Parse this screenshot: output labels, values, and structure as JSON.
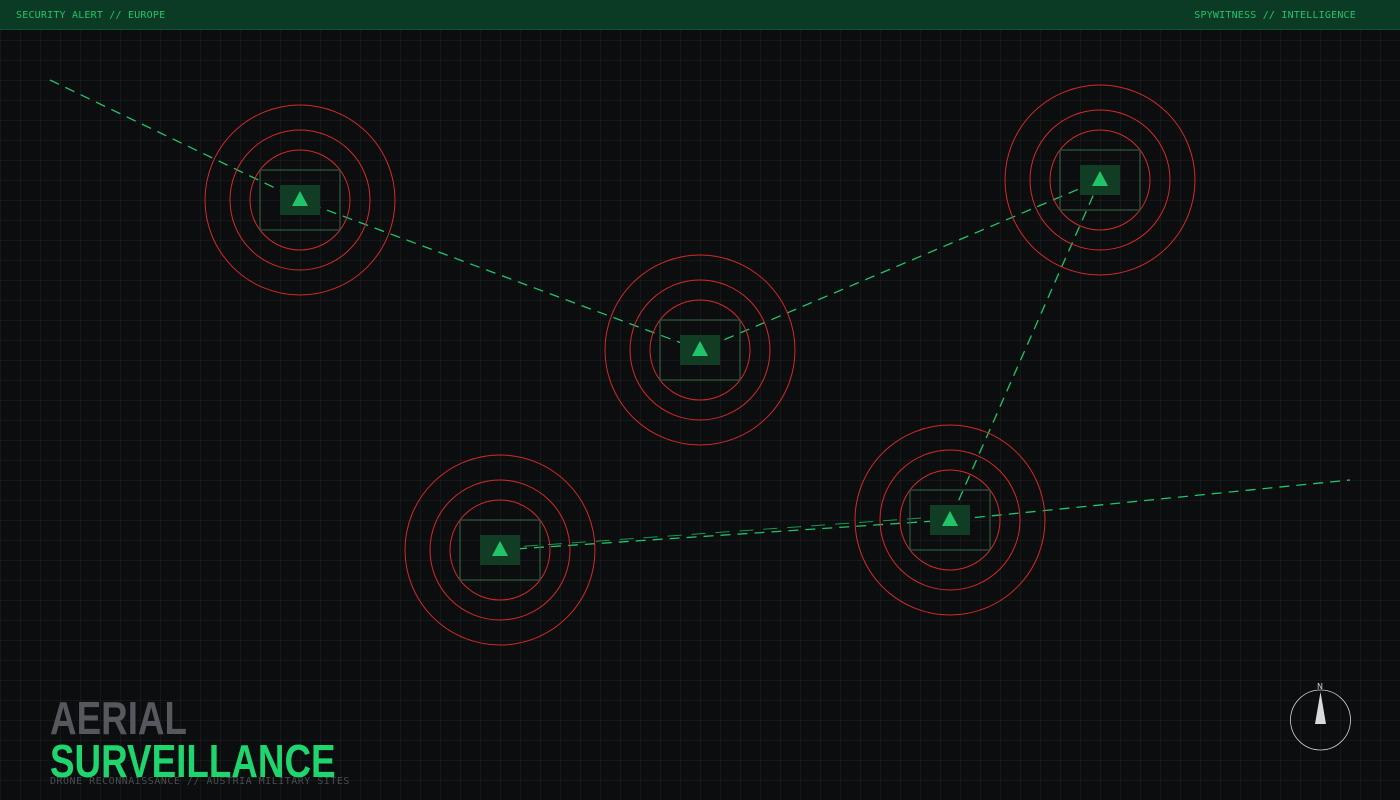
{
  "header": {
    "left_label": "SECURITY ALERT // EUROPE",
    "right_label": "SPYWITNESS // INTELLIGENCE"
  },
  "title": {
    "line1": "AERIAL",
    "line2": "SURVEILLANCE",
    "subtitle": "DRONE RECONNAISSANCE // AUSTRIA MILITARY SITES"
  },
  "compass": {
    "label": "N"
  },
  "colors": {
    "accent": "#22c46a",
    "alert_ring": "#d42a2a",
    "site_box": "#2f5a3c",
    "header_bg": "#0b3a25"
  },
  "sites": [
    {
      "id": "site-1"
    },
    {
      "id": "site-2"
    },
    {
      "id": "site-3"
    },
    {
      "id": "site-4"
    },
    {
      "id": "site-5"
    }
  ]
}
